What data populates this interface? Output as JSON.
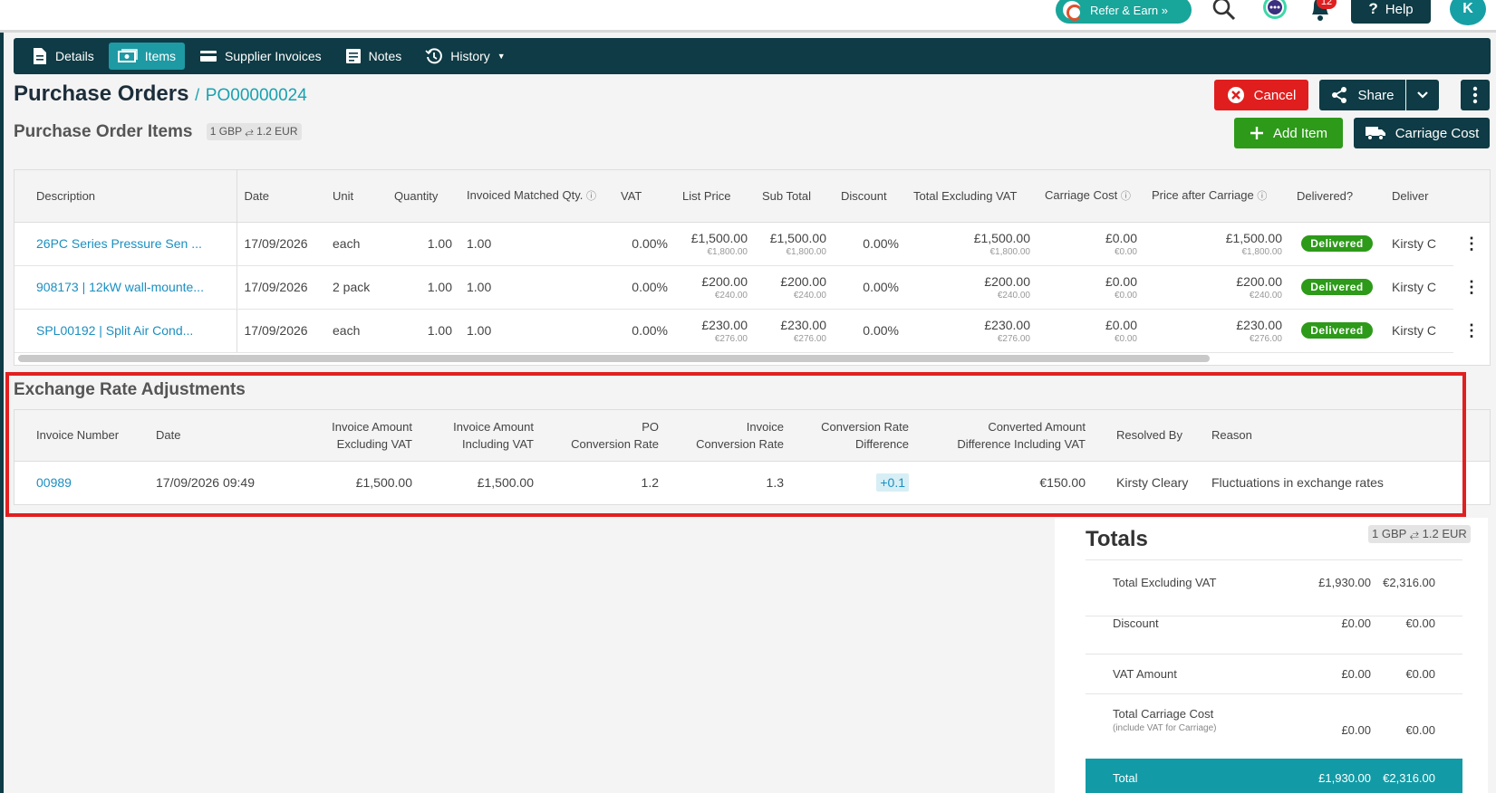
{
  "topbar": {
    "refer_label": "Refer & Earn »",
    "notifications_count": "12",
    "help_label": "Help",
    "avatar_initial": "K"
  },
  "nav": {
    "items": [
      {
        "label": "Details",
        "icon": "document-icon",
        "active": false
      },
      {
        "label": "Items",
        "icon": "money-icon",
        "active": true
      },
      {
        "label": "Supplier Invoices",
        "icon": "card-icon",
        "active": false
      },
      {
        "label": "Notes",
        "icon": "note-icon",
        "active": false
      },
      {
        "label": "History",
        "icon": "history-icon",
        "active": false
      }
    ]
  },
  "header": {
    "title": "Purchase Orders",
    "separator": "/",
    "po_number": "PO00000024",
    "subtitle": "Purchase Order Items",
    "rate_label": "1 GBP ⥄ 1.2 EUR"
  },
  "actions": {
    "cancel": "Cancel",
    "share": "Share",
    "add_item": "Add Item",
    "carriage_cost": "Carriage Cost"
  },
  "items_table": {
    "columns": [
      "Description",
      "Date",
      "Unit",
      "Quantity",
      "Invoiced Matched Qty.",
      "VAT",
      "List Price",
      "Sub Total",
      "Discount",
      "Total Excluding VAT",
      "Carriage Cost",
      "Price after Carriage",
      "Delivered?",
      "Deliver"
    ],
    "rows": [
      {
        "description": "26PC Series Pressure Sen ...",
        "date": "17/09/2026",
        "unit": "each",
        "quantity": "1.00",
        "invoiced": "1.00",
        "vat": "0.00%",
        "list_price": "£1,500.00",
        "list_price_eur": "€1,800.00",
        "sub_total": "£1,500.00",
        "sub_total_eur": "€1,800.00",
        "discount": "0.00%",
        "total_ex_vat": "£1,500.00",
        "total_ex_vat_eur": "€1,800.00",
        "carriage": "£0.00",
        "carriage_eur": "€0.00",
        "after_carriage": "£1,500.00",
        "after_carriage_eur": "€1,800.00",
        "delivered": "Delivered",
        "delivered_by": "Kirsty C"
      },
      {
        "description": "908173 | 12kW wall-mounte...",
        "date": "17/09/2026",
        "unit": "2 pack",
        "quantity": "1.00",
        "invoiced": "1.00",
        "vat": "0.00%",
        "list_price": "£200.00",
        "list_price_eur": "€240.00",
        "sub_total": "£200.00",
        "sub_total_eur": "€240.00",
        "discount": "0.00%",
        "total_ex_vat": "£200.00",
        "total_ex_vat_eur": "€240.00",
        "carriage": "£0.00",
        "carriage_eur": "€0.00",
        "after_carriage": "£200.00",
        "after_carriage_eur": "€240.00",
        "delivered": "Delivered",
        "delivered_by": "Kirsty C"
      },
      {
        "description": "SPL00192 | Split Air Cond...",
        "date": "17/09/2026",
        "unit": "each",
        "quantity": "1.00",
        "invoiced": "1.00",
        "vat": "0.00%",
        "list_price": "£230.00",
        "list_price_eur": "€276.00",
        "sub_total": "£230.00",
        "sub_total_eur": "€276.00",
        "discount": "0.00%",
        "total_ex_vat": "£230.00",
        "total_ex_vat_eur": "€276.00",
        "carriage": "£0.00",
        "carriage_eur": "€0.00",
        "after_carriage": "£230.00",
        "after_carriage_eur": "€276.00",
        "delivered": "Delivered",
        "delivered_by": "Kirsty C"
      }
    ]
  },
  "exchange": {
    "title": "Exchange Rate Adjustments",
    "columns": {
      "invoice_number": "Invoice Number",
      "date": "Date",
      "inv_ex_1": "Invoice Amount",
      "inv_ex_2": "Excluding VAT",
      "inv_inc_1": "Invoice Amount",
      "inv_inc_2": "Including VAT",
      "po_rate_1": "PO",
      "po_rate_2": "Conversion Rate",
      "inv_rate_1": "Invoice",
      "inv_rate_2": "Conversion Rate",
      "diff_1": "Conversion Rate",
      "diff_2": "Difference",
      "conv_1": "Converted Amount",
      "conv_2": "Difference Including VAT",
      "resolved_by": "Resolved By",
      "reason": "Reason"
    },
    "row": {
      "invoice_number": "00989",
      "date": "17/09/2026 09:49",
      "inv_ex": "£1,500.00",
      "inv_inc": "£1,500.00",
      "po_rate": "1.2",
      "inv_rate": "1.3",
      "diff": "+0.1",
      "converted": "€150.00",
      "resolved_by": "Kirsty Cleary",
      "reason": "Fluctuations in exchange rates"
    }
  },
  "totals": {
    "title": "Totals",
    "rate_label": "1 GBP ⥄ 1.2 EUR",
    "rows": [
      {
        "label": "Total Excluding VAT",
        "gbp": "£1,930.00",
        "eur": "€2,316.00"
      },
      {
        "label": "Discount",
        "gbp": "£0.00",
        "eur": "€0.00"
      },
      {
        "label": "VAT Amount",
        "gbp": "£0.00",
        "eur": "€0.00"
      },
      {
        "label": "Total Carriage Cost",
        "note": "(include VAT for Carriage)",
        "gbp": "£0.00",
        "eur": "€0.00"
      }
    ],
    "total": {
      "label": "Total",
      "gbp": "£1,930.00",
      "eur": "€2,316.00"
    }
  },
  "colors": {
    "navy": "#0e3b45",
    "teal": "#17a2b0",
    "red": "#e01e1e",
    "green": "#2d9a19"
  }
}
